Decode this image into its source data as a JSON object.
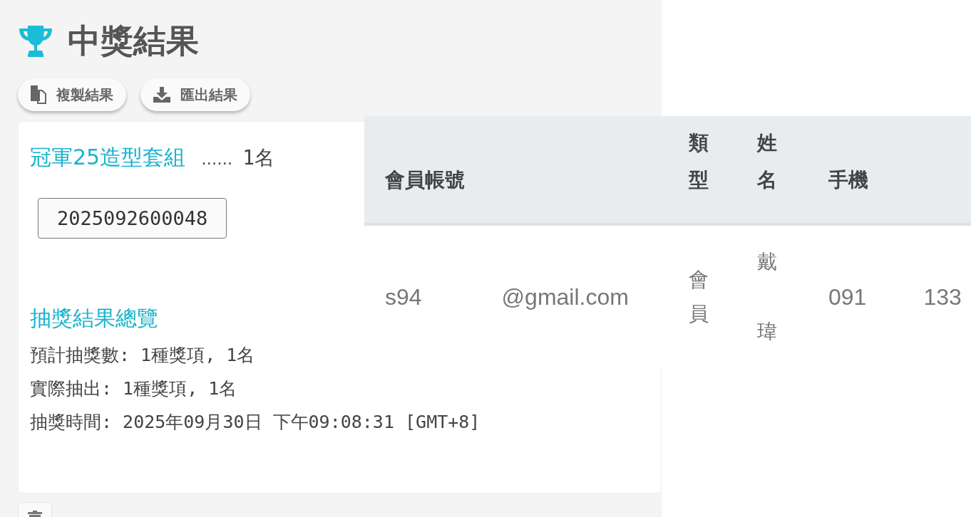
{
  "title": "中獎結果",
  "actions": [
    {
      "label": "複製結果",
      "kind": "copy"
    },
    {
      "label": "匯出結果",
      "kind": "download"
    }
  ],
  "prize": {
    "name": "冠軍25造型套組",
    "dots": "……",
    "count": "1名",
    "codes": [
      "2025092600048"
    ]
  },
  "summary": {
    "heading": "抽獎結果總覽",
    "lines": [
      "預計抽獎數: 1種獎項, 1名",
      "實際抽出: 1種獎項, 1名",
      "抽獎時間: 2025年09月30日 下午09:08:31 [GMT+8]"
    ]
  },
  "table": {
    "columns": [
      "會員帳號",
      "類型",
      "姓名",
      "手機"
    ],
    "rows": [
      {
        "account": [
          "s94",
          "@gmail.com"
        ],
        "type": "會員",
        "name": [
          "戴",
          "瑋"
        ],
        "phone": [
          "091",
          "133"
        ]
      }
    ]
  }
}
